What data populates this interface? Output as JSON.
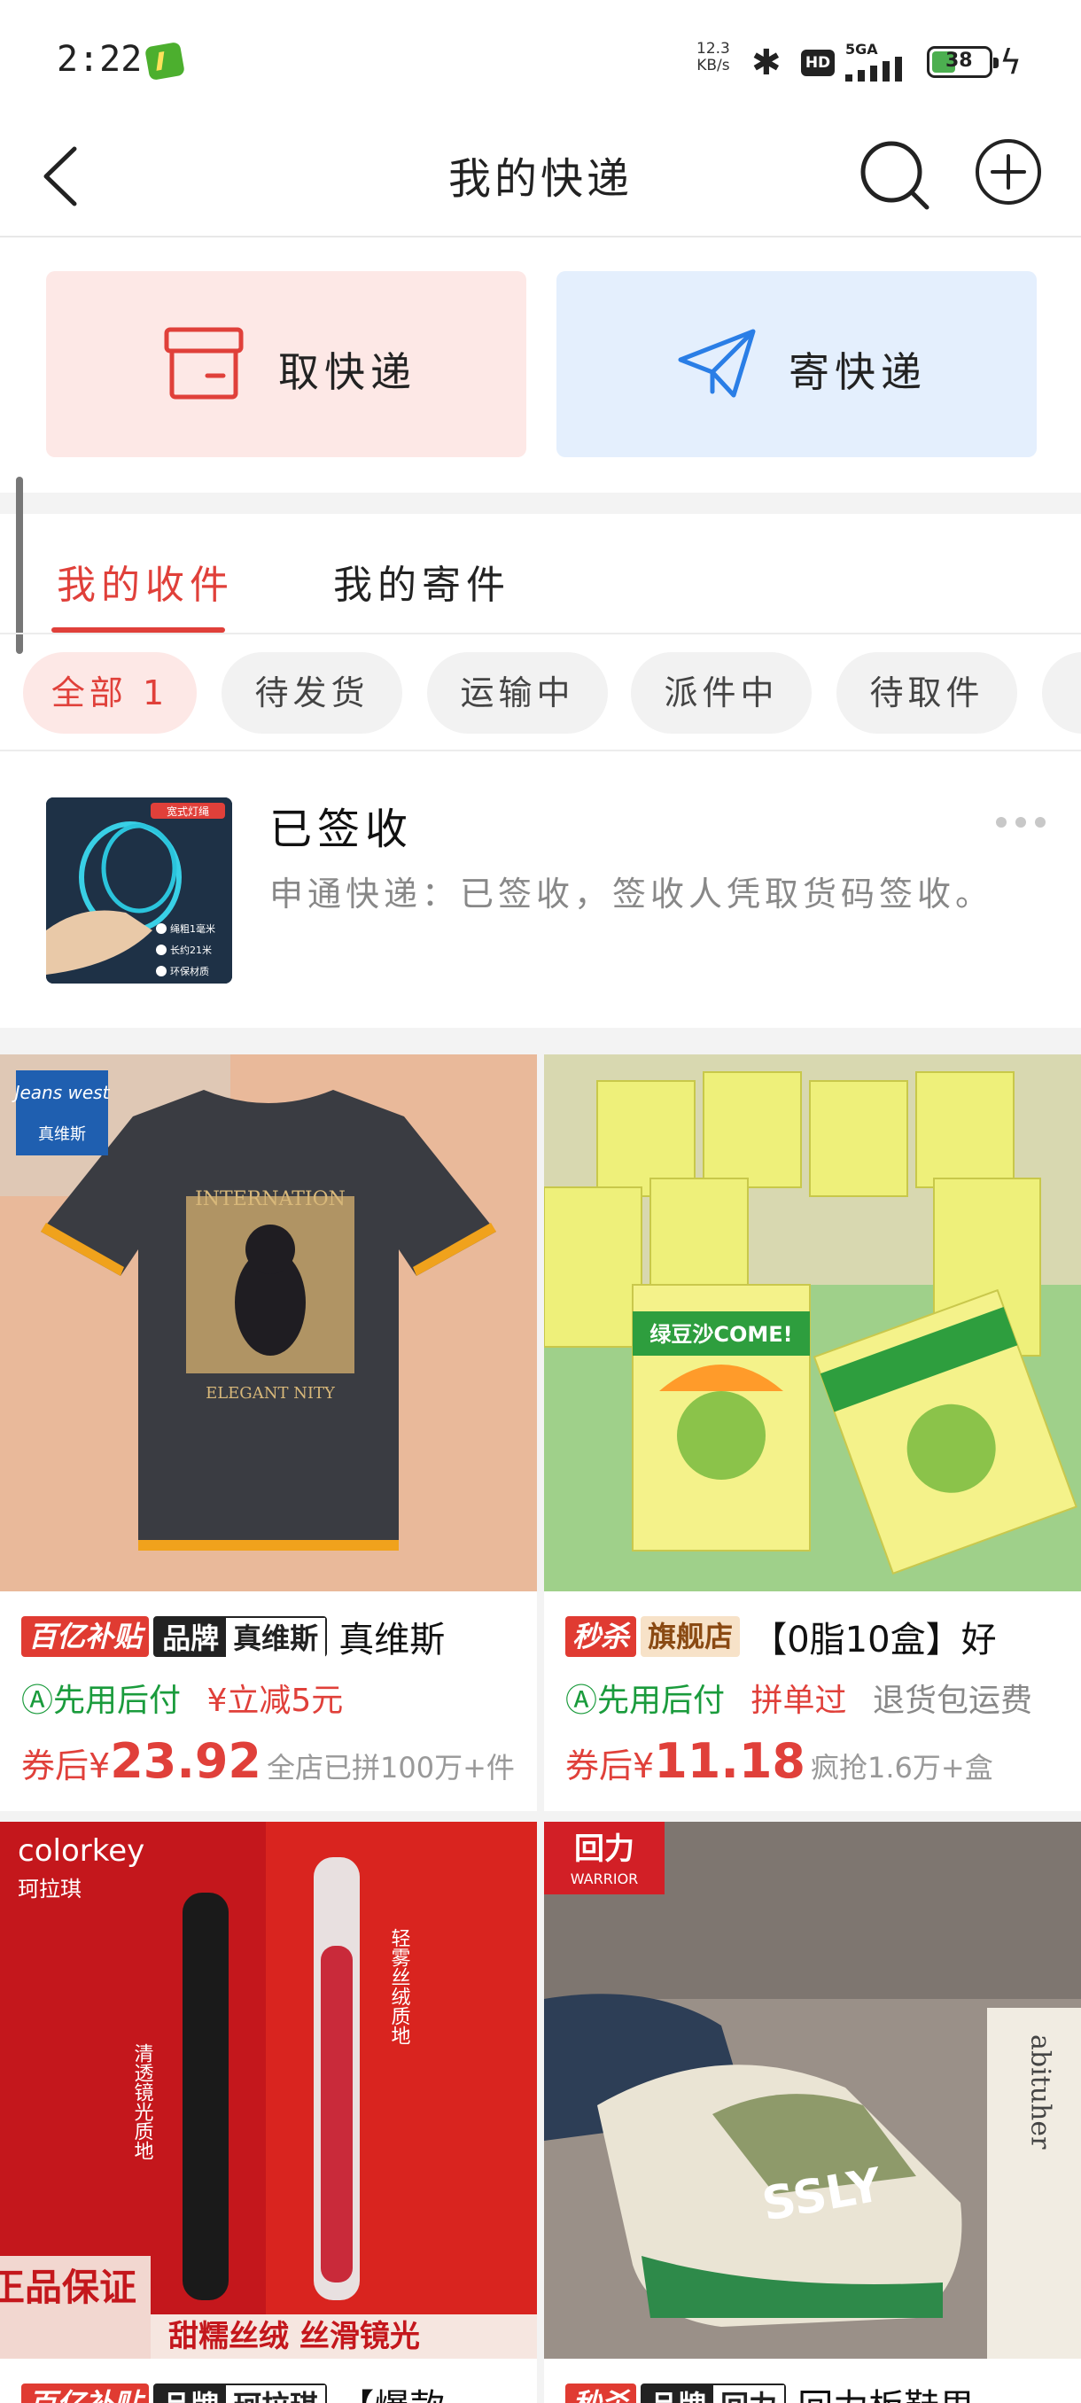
{
  "status_bar": {
    "time": "2:22",
    "net_speed_value": "12.3",
    "net_speed_unit": "KB/s",
    "hd": "HD",
    "signal_label": "5GA",
    "battery": "38"
  },
  "header": {
    "title": "我的快递",
    "icons": [
      "back-icon",
      "search-icon",
      "add-icon"
    ]
  },
  "actions": {
    "receive_label": "取快递",
    "send_label": "寄快递"
  },
  "tabs": {
    "received": "我的收件",
    "sent": "我的寄件"
  },
  "filters": [
    {
      "label": "全部 1",
      "active": true
    },
    {
      "label": "待发货",
      "active": false
    },
    {
      "label": "运输中",
      "active": false
    },
    {
      "label": "派件中",
      "active": false
    },
    {
      "label": "待取件",
      "active": false
    }
  ],
  "package": {
    "status": "已签收",
    "desc": "申通快递：已签收，签收人凭取货码签收。",
    "thumb_labels": {
      "badge": "宽式灯绳",
      "line1": "绳粗1毫米",
      "line2": "长约21米",
      "line3": "环保材质"
    }
  },
  "products": [
    {
      "image_label": {
        "brand": "Jeans west",
        "brand_cn": "真维斯",
        "print_top": "INTERNATION",
        "print_bottom": "ELEGANT NITY"
      },
      "tag1": "百亿补贴",
      "tag2_a": "品牌",
      "tag2_b": "真维斯",
      "name": "真维斯",
      "sub1": "先用后付",
      "sub2": "立减5元",
      "sub3": "",
      "price_pre": "券后¥",
      "price": "23.92",
      "price_note": "全店已拼100万+件"
    },
    {
      "image_label": {
        "box": "绿豆沙COME!"
      },
      "tag1": "秒杀",
      "tag2_a": "旗舰店",
      "tag2_b": "",
      "name": "【0脂10盒】好",
      "sub1": "先用后付",
      "sub2": "拼单过",
      "sub3": "退货包运费",
      "price_pre": "券后¥",
      "price": "11.18",
      "price_note": "疯抢1.6万+盒"
    },
    {
      "image_label": {
        "brand": "colorkey",
        "brand_cn": "珂拉琪",
        "side1": "清透镜光质地",
        "side2": "轻雾丝绒质地",
        "guarantee": "正品保证",
        "banner": "甜糯丝绒 丝滑镜光"
      },
      "tag1": "百亿补贴",
      "tag2_a": "品牌",
      "tag2_b": "珂拉琪",
      "name": "【爆款",
      "sub1": "",
      "sub2": "",
      "sub3": "",
      "price_pre": "",
      "price": "",
      "price_note": ""
    },
    {
      "image_label": {
        "brand": "回力",
        "brand_en": "WARRIOR",
        "paper": "abituher"
      },
      "tag1": "秒杀",
      "tag2_a": "品牌",
      "tag2_b": "回力",
      "name": "回力板鞋男",
      "sub1": "",
      "sub2": "",
      "sub3": "",
      "price_pre": "",
      "price": "",
      "price_note": ""
    }
  ],
  "colors": {
    "accent": "#e0403a",
    "receive_bg": "#fde8e6",
    "send_bg": "#e4effd",
    "send_icon": "#2a7ee6",
    "green": "#1a9b3c"
  }
}
